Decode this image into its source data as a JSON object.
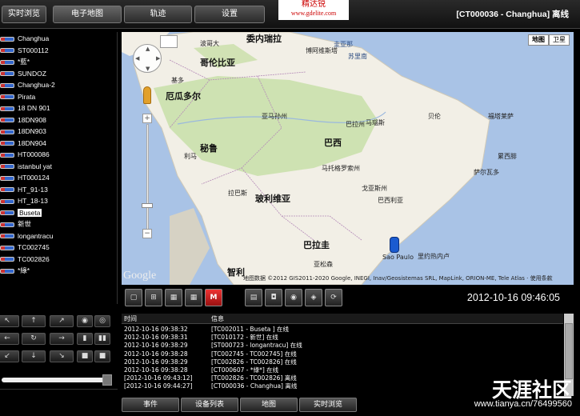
{
  "nav": {
    "tabs": [
      {
        "label": "实时浏览"
      },
      {
        "label": "电子地图"
      },
      {
        "label": "轨迹"
      },
      {
        "label": "设置"
      }
    ],
    "brand_cn": "精达锐",
    "brand_url": "www.gdelite.com",
    "device_title": "[CT000036 - Changhua] 离线"
  },
  "vehicles": [
    {
      "label": "Changhua"
    },
    {
      "label": "ST000112"
    },
    {
      "label": "*藍*"
    },
    {
      "label": "SUNDOZ"
    },
    {
      "label": "Changhua-2"
    },
    {
      "label": "Pirata"
    },
    {
      "label": "18 DN 901"
    },
    {
      "label": "18DN908"
    },
    {
      "label": "18DN903"
    },
    {
      "label": "18DN904"
    },
    {
      "label": "HT000086"
    },
    {
      "label": "istanbul yat"
    },
    {
      "label": "HT000124"
    },
    {
      "label": "HT_91-13"
    },
    {
      "label": "HT_18-13"
    },
    {
      "label": "Buseta"
    },
    {
      "label": "新世"
    },
    {
      "label": "longantracu"
    },
    {
      "label": "TC002745"
    },
    {
      "label": "TC002826"
    },
    {
      "label": "*綠*"
    }
  ],
  "selected_vehicle": "Buseta",
  "map": {
    "type_buttons": [
      {
        "label": "地图"
      },
      {
        "label": "卫星"
      }
    ],
    "labels": {
      "venezuela": "委内瑞拉",
      "colombia": "哥伦比亚",
      "ecuador": "厄瓜多尔",
      "peru": "秘鲁",
      "brazil": "巴西",
      "bolivia": "玻利维亚",
      "paraguay": "巴拉圭",
      "chile": "智利",
      "boa_vista": "博阿维斯塔",
      "bogota": "波哥大",
      "manaus": "马瑙斯",
      "belem": "贝伦",
      "fortaleza": "福塔莱萨",
      "recife": "累西腓",
      "salvador": "萨尔瓦多",
      "brasilia": "巴西利亚",
      "sao_paulo": "Sao Paulo",
      "rio": "里约热内卢",
      "amazonas": "亚马孙州",
      "para": "巴拉州",
      "mato_grosso": "马托格罗索州",
      "goias": "戈亚斯州",
      "la_paz": "拉巴斯",
      "asuncion": "亚松森",
      "lima": "利马",
      "quito": "基多",
      "guiana": "圭亚那",
      "suriname": "苏里南"
    },
    "zoom_plus": "+",
    "zoom_minus": "−",
    "logo": "Google",
    "copyright": "地图数据 ©2012 GIS2011-2020 Google, INEGI, Inav/Geosistemas SRL, MapLink, ORION-ME, Tele Atlas · 使用条款"
  },
  "toolbar": {
    "red_label": "M",
    "clock": "2012-10-16 09:46:05"
  },
  "log": {
    "col_time": "时间",
    "col_info": "信息",
    "rows": [
      {
        "time": "2012-10-16 09:38:32",
        "msg": "[TC002011 - Buseta ] 在线"
      },
      {
        "time": "2012-10-16 09:38:31",
        "msg": "[TC010172 - 新世] 在线"
      },
      {
        "time": "2012-10-16 09:38:29",
        "msg": "[ST000723 - longantracu] 在线"
      },
      {
        "time": "2012-10-16 09:38:28",
        "msg": "[TC002745 - TC002745] 在线"
      },
      {
        "time": "2012-10-16 09:38:29",
        "msg": "[TC002826 - TC002826] 在线"
      },
      {
        "time": "2012-10-16 09:38:28",
        "msg": "[CT000607 - *綠*] 在线"
      },
      {
        "time": "[2012-10-16 09:43:12]",
        "msg": "[TC002826 - TC002826] 离线"
      },
      {
        "time": "[2012-10-16 09:44:27]",
        "msg": "[CT000036 - Changhua] 离线"
      }
    ]
  },
  "bottom_tabs": [
    {
      "label": "事件"
    },
    {
      "label": "设备列表"
    },
    {
      "label": "地图"
    },
    {
      "label": "实时浏览"
    }
  ],
  "watermark": "天涯社区",
  "watermark_url": "www.tianya.cn/76499560",
  "colors": {
    "accent_red": "#cc0000",
    "marker_blue": "#1a5bd0",
    "land": "#f2efe6",
    "water": "#a9c3e6",
    "forest": "#c8dfa8"
  }
}
